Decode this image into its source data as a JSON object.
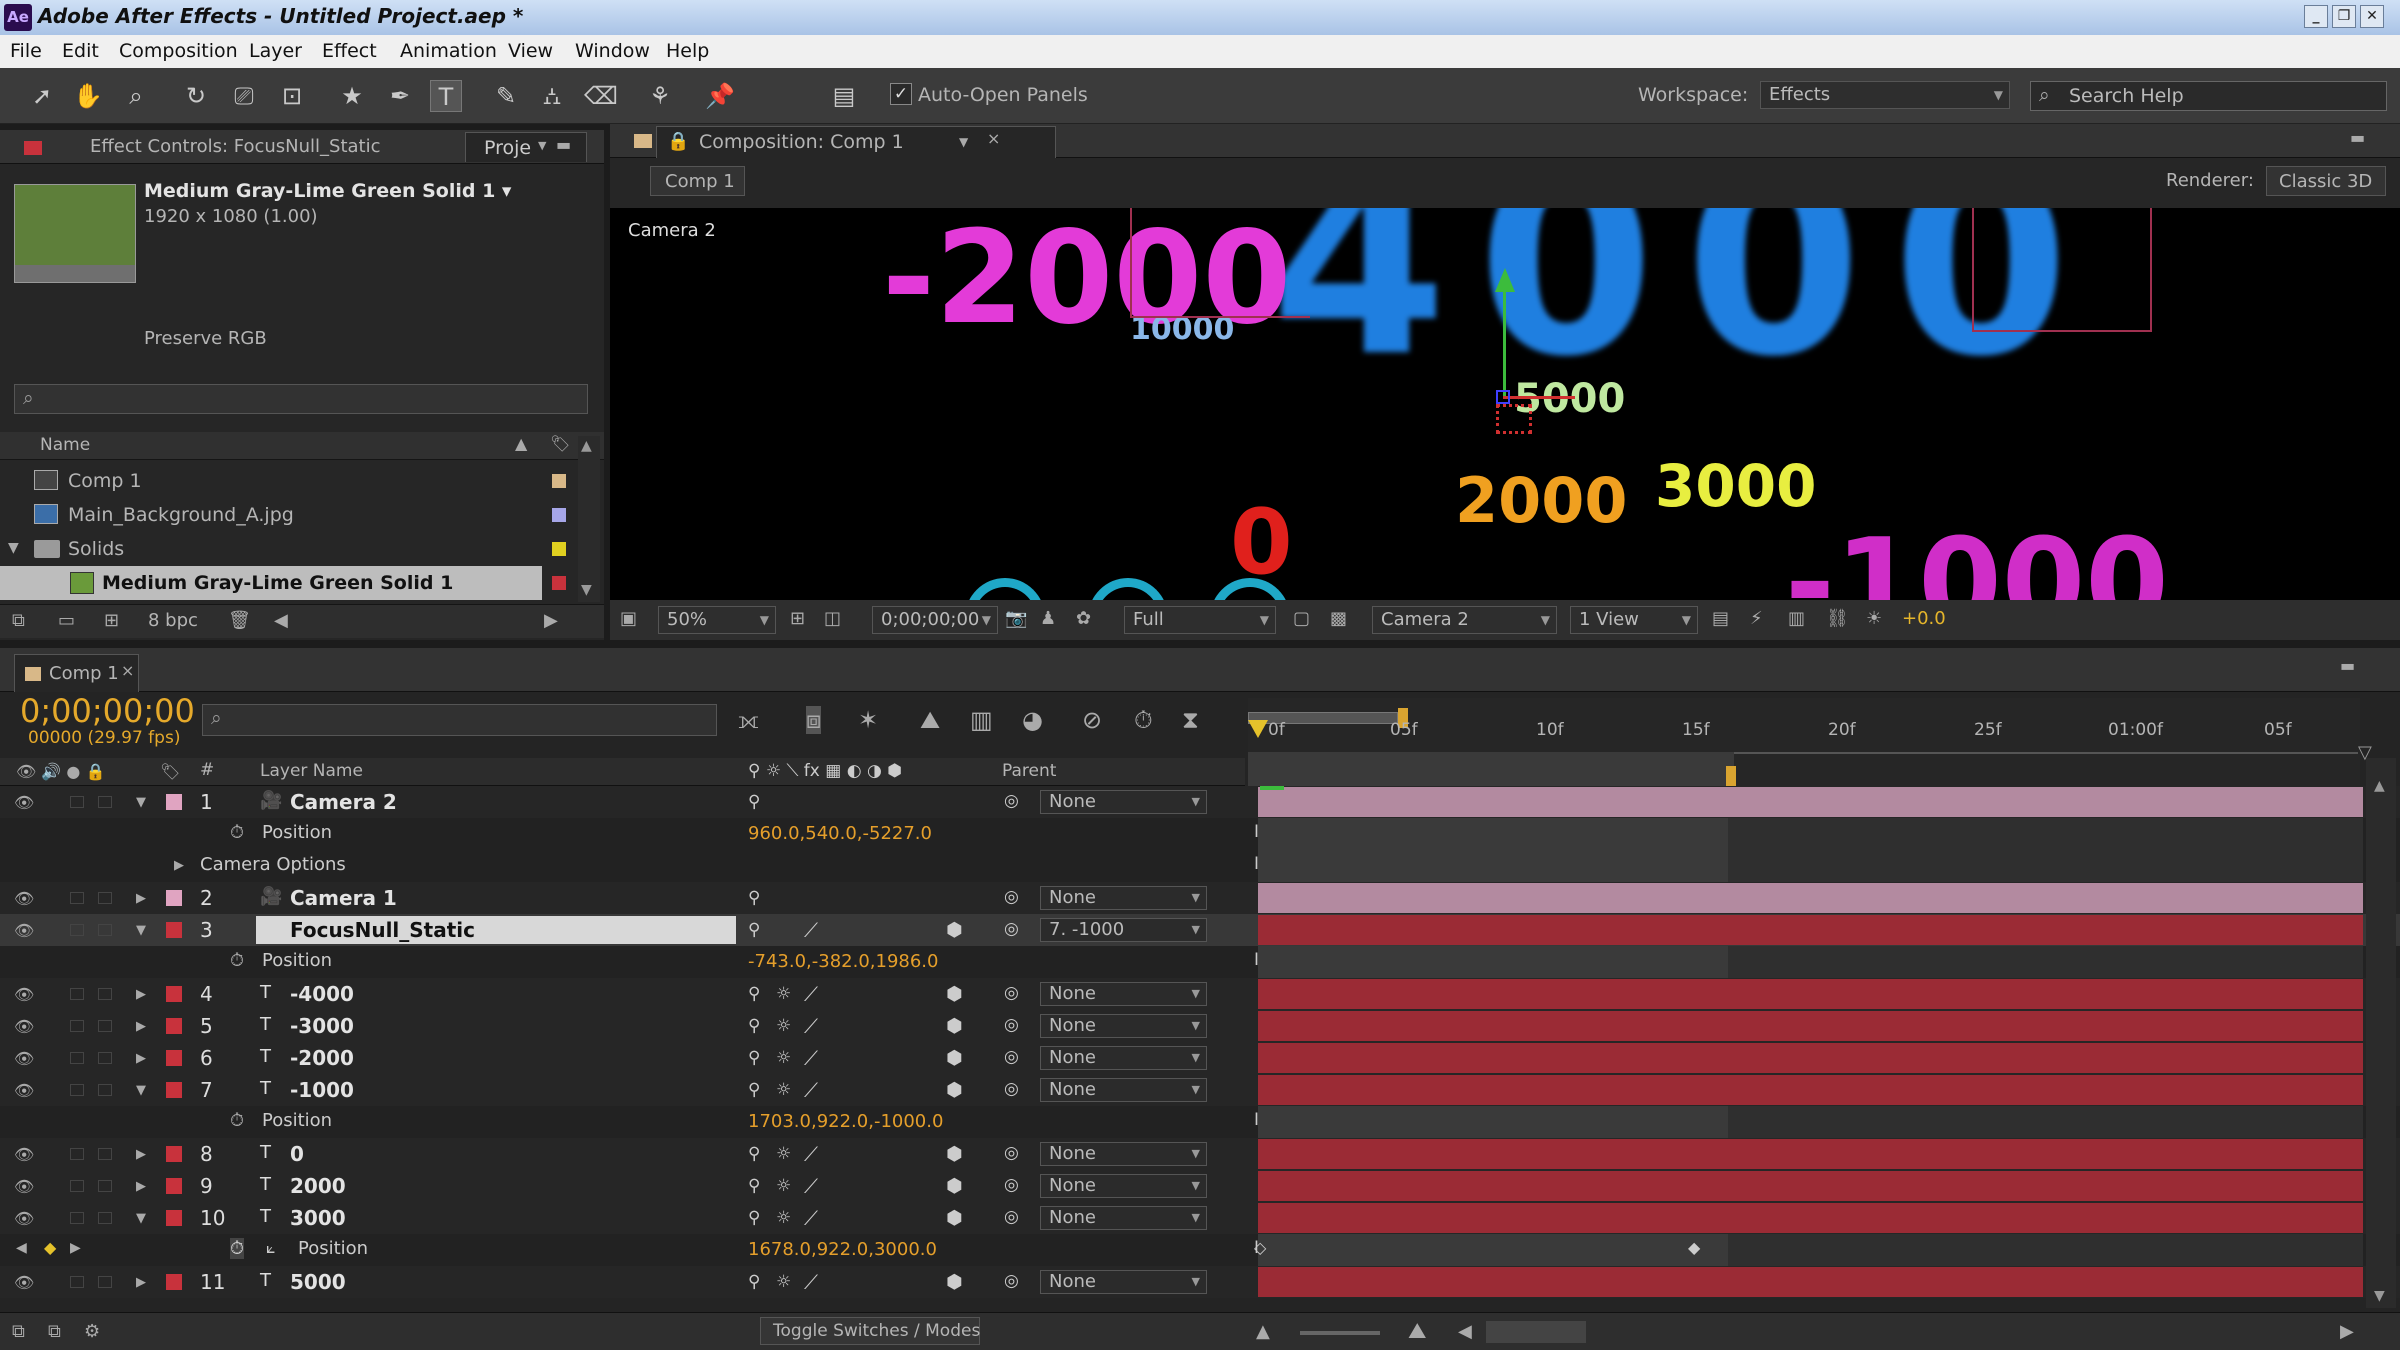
{
  "window": {
    "title": "Adobe After Effects - Untitled Project.aep *",
    "app_icon": "Ae"
  },
  "menu": [
    "File",
    "Edit",
    "Composition",
    "Layer",
    "Effect",
    "Animation",
    "View",
    "Window",
    "Help"
  ],
  "toolbar": {
    "auto_open_label": "Auto-Open Panels",
    "auto_open_checked": true,
    "workspace_label": "Workspace:",
    "workspace_value": "Effects",
    "search_placeholder": "Search Help"
  },
  "project_panel": {
    "tab_effect_controls": "Effect Controls: FocusNull_Static",
    "tab_project": "Proje",
    "item_name": "Medium Gray-Lime Green Solid 1 ▾",
    "item_dims": "1920 x 1080 (1.00)",
    "item_desc": "Preserve RGB",
    "col_name": "Name",
    "items": [
      {
        "name": "Comp 1",
        "type": "comp"
      },
      {
        "name": "Main_Background_A.jpg",
        "type": "image"
      },
      {
        "name": "Solids",
        "type": "folder"
      },
      {
        "name": "Medium Gray-Lime Green Solid 1",
        "type": "solid"
      }
    ],
    "bpc": "8 bpc"
  },
  "comp_panel": {
    "tab": "Composition: Comp 1",
    "breadcrumb": "Comp 1",
    "renderer_label": "Renderer:",
    "renderer_value": "Classic 3D",
    "camera_label": "Camera 2",
    "zoom": "50%",
    "time": "0;00;00;00",
    "resolution": "Full",
    "view_camera": "Camera 2",
    "views": "1 View",
    "exposure": "+0.0"
  },
  "viewport_text": [
    {
      "t": "-2000",
      "c": "#e33bd8"
    },
    {
      "t": "4000",
      "c": "#1f7fe0"
    },
    {
      "t": "10000",
      "c": "#8ab7e8"
    },
    {
      "t": "5000",
      "c": "#bfe8a0"
    },
    {
      "t": "2000",
      "c": "#f0a020"
    },
    {
      "t": "3000",
      "c": "#e8ee40"
    },
    {
      "t": "0",
      "c": "#e0201c"
    },
    {
      "t": "-1000",
      "c": "#d02ec8"
    }
  ],
  "timeline": {
    "tab": "Comp 1",
    "timecode": "0;00;00;00",
    "frame_info": "00000 (29.97 fps)",
    "col_layer_name": "Layer Name",
    "col_num": "#",
    "col_parent": "Parent",
    "ruler": [
      "0f",
      "05f",
      "10f",
      "15f",
      "20f",
      "25f",
      "01:00f",
      "05f"
    ],
    "toggle_label": "Toggle Switches / Modes",
    "layers": [
      {
        "kind": "layer",
        "num": "1",
        "name": "Camera 2",
        "type": "camera",
        "expanded": true,
        "parent": "None",
        "label": "#e0a4c1"
      },
      {
        "kind": "prop",
        "name": "Position",
        "value": "960.0,540.0,-5227.0"
      },
      {
        "kind": "group",
        "name": "Camera Options"
      },
      {
        "kind": "layer",
        "num": "2",
        "name": "Camera 1",
        "type": "camera",
        "expanded": false,
        "parent": "None",
        "label": "#e0a4c1"
      },
      {
        "kind": "layer",
        "num": "3",
        "name": "FocusNull_Static",
        "type": "null",
        "expanded": true,
        "parent": "7. -1000",
        "label": "#c8323c",
        "selected": true
      },
      {
        "kind": "prop",
        "name": "Position",
        "value": "-743.0,-382.0,1986.0"
      },
      {
        "kind": "layer",
        "num": "4",
        "name": "-4000",
        "type": "text",
        "expanded": false,
        "parent": "None",
        "label": "#c8323c"
      },
      {
        "kind": "layer",
        "num": "5",
        "name": "-3000",
        "type": "text",
        "expanded": false,
        "parent": "None",
        "label": "#c8323c"
      },
      {
        "kind": "layer",
        "num": "6",
        "name": "-2000",
        "type": "text",
        "expanded": false,
        "parent": "None",
        "label": "#c8323c"
      },
      {
        "kind": "layer",
        "num": "7",
        "name": "-1000",
        "type": "text",
        "expanded": true,
        "parent": "None",
        "label": "#c8323c"
      },
      {
        "kind": "prop",
        "name": "Position",
        "value": "1703.0,922.0,-1000.0"
      },
      {
        "kind": "layer",
        "num": "8",
        "name": "0",
        "type": "text",
        "expanded": false,
        "parent": "None",
        "label": "#c8323c"
      },
      {
        "kind": "layer",
        "num": "9",
        "name": "2000",
        "type": "text",
        "expanded": false,
        "parent": "None",
        "label": "#c8323c"
      },
      {
        "kind": "layer",
        "num": "10",
        "name": "3000",
        "type": "text",
        "expanded": true,
        "parent": "None",
        "label": "#c8323c"
      },
      {
        "kind": "prop",
        "name": "Position",
        "value": "1678.0,922.0,3000.0",
        "keyframed": true
      },
      {
        "kind": "layer",
        "num": "11",
        "name": "5000",
        "type": "text",
        "expanded": false,
        "parent": "None",
        "label": "#c8323c"
      }
    ]
  }
}
